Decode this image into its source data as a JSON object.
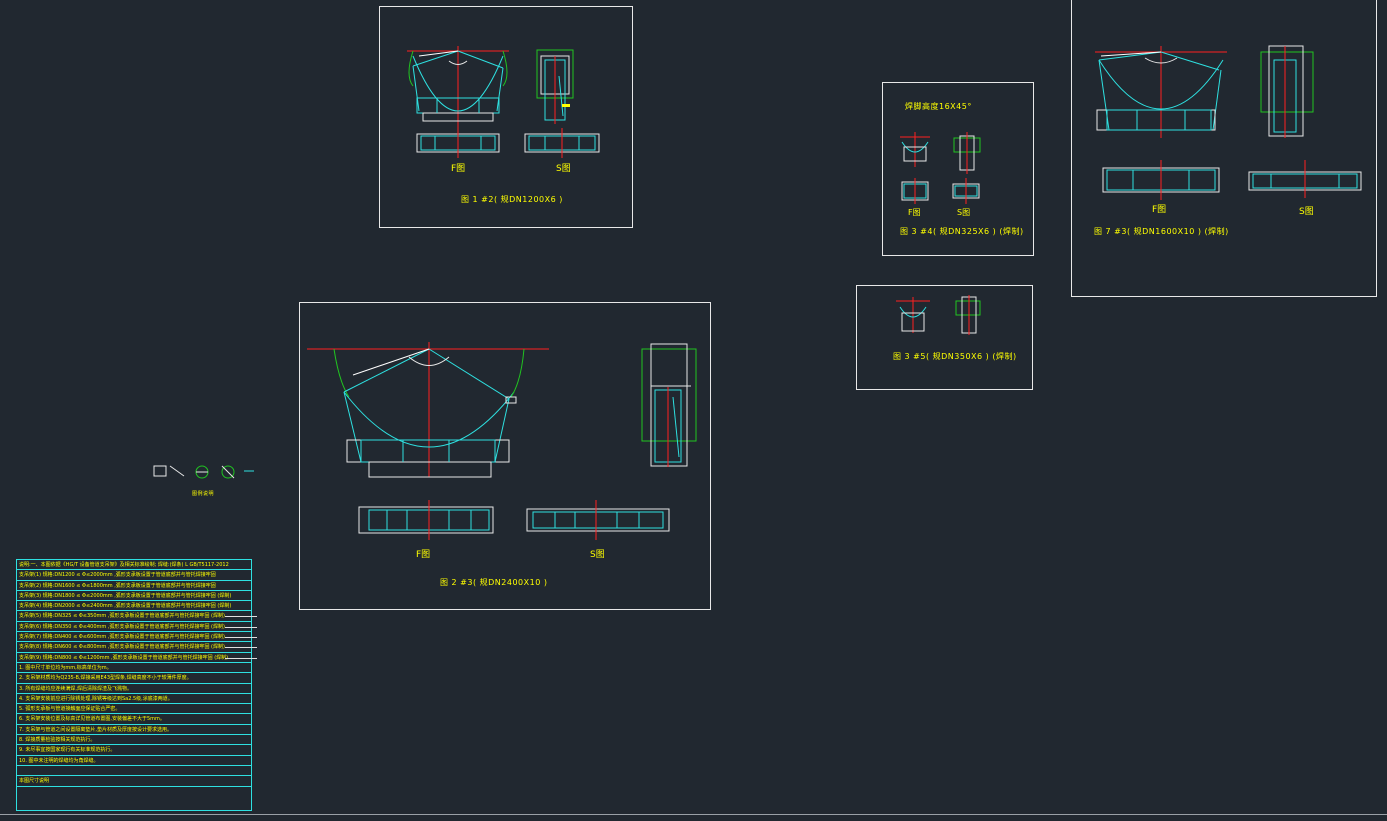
{
  "drawings": [
    {
      "id": "fig1",
      "caption": "图 1  #2(  规DN1200X6 )",
      "f_label": "F图",
      "s_label": "S图"
    },
    {
      "id": "fig2",
      "caption": "图 2  #3(  规DN2400X10 )",
      "f_label": "F图",
      "s_label": "S图"
    },
    {
      "id": "fig3a",
      "note": "焊脚高度16X45°",
      "caption": "图 3  #4(  规DN325X6 ) (焊制)",
      "f_label": "F图",
      "s_label": "S图"
    },
    {
      "id": "fig3b",
      "caption": "图 3  #5(  规DN350X6 ) (焊制)"
    },
    {
      "id": "fig7",
      "caption": "图 7  #3(  规DN1600X10 ) (焊制)",
      "f_label": "F图",
      "s_label": "S图"
    }
  ],
  "legend_caption": "图例说明",
  "notes": [
    "说明:一、本图依据《HG/T 设备管道支吊架》及相关标准绘制;    焊缝:(焊条)  L  GB/T5117-2012",
    "支吊架(1) 规格:DN1200 ≤ Φ≤2000mm ,弧形支承板设置于管道底部并与管托焊接牢固",
    "支吊架(2) 规格:DN1600 ≤ Φ≤1800mm ,弧形支承板设置于管道底部并与管托焊接牢固",
    "支吊架(3) 规格:DN1800 ≤ Φ≤2000mm ,弧形支承板设置于管道底部并与管托焊接牢固  (焊制)",
    "支吊架(4) 规格:DN2000 ≤ Φ≤2400mm ,弧形支承板设置于管道底部并与管托焊接牢固  (焊制)",
    "支吊架(5) 规格:DN325 ≤ Φ≤350mm ,弧形支承板设置于管道底部并与管托焊接牢固  (焊制)",
    "支吊架(6) 规格:DN350 ≤ Φ≤400mm ,弧形支承板设置于管道底部并与管托焊接牢固  (焊制)",
    "支吊架(7) 规格:DN400 ≤ Φ≤600mm ,弧形支承板设置于管道底部并与管托焊接牢固  (焊制)",
    "支吊架(8) 规格:DN600 ≤ Φ≤800mm ,弧形支承板设置于管道底部并与管托焊接牢固  (焊制)",
    "支吊架(9) 规格:DN800 ≤ Φ≤1200mm ,弧形支承板设置于管道底部并与管托焊接牢固  (焊制)",
    "1. 图中尺寸单位均为mm,标高单位为m。",
    "2. 支吊架材质均为Q235-B,焊接采用E43型焊条,焊缝高度不小于较薄件厚度。",
    "3. 所有焊缝均应连续满焊,焊后清除焊渣及飞溅物。",
    "4. 支吊架安装前应进行除锈处理,除锈等级达到Sa2.5级,涂底漆两道。",
    "5. 弧形支承板与管道接触面应保证贴合严密。",
    "6. 支吊架安装位置及标高详见管道布置图,安装偏差不大于5mm。",
    "7. 支吊架与管道之间设置隔离垫片,垫片材质及厚度按设计要求选用。",
    "8. 焊接质量检验按相关规范执行。",
    "9. 未尽事宜按国家现行有关标准规范执行。",
    "10. 图中未注明的焊缝均为角焊缝。",
    "",
    "本图尺寸说明"
  ],
  "colors": {
    "background": "#212830",
    "frame": "#e8e8e8",
    "cyan": "#2ee0e0",
    "red": "#ff2020",
    "green": "#21c421",
    "yellow": "#ffff00",
    "white": "#ffffff"
  }
}
